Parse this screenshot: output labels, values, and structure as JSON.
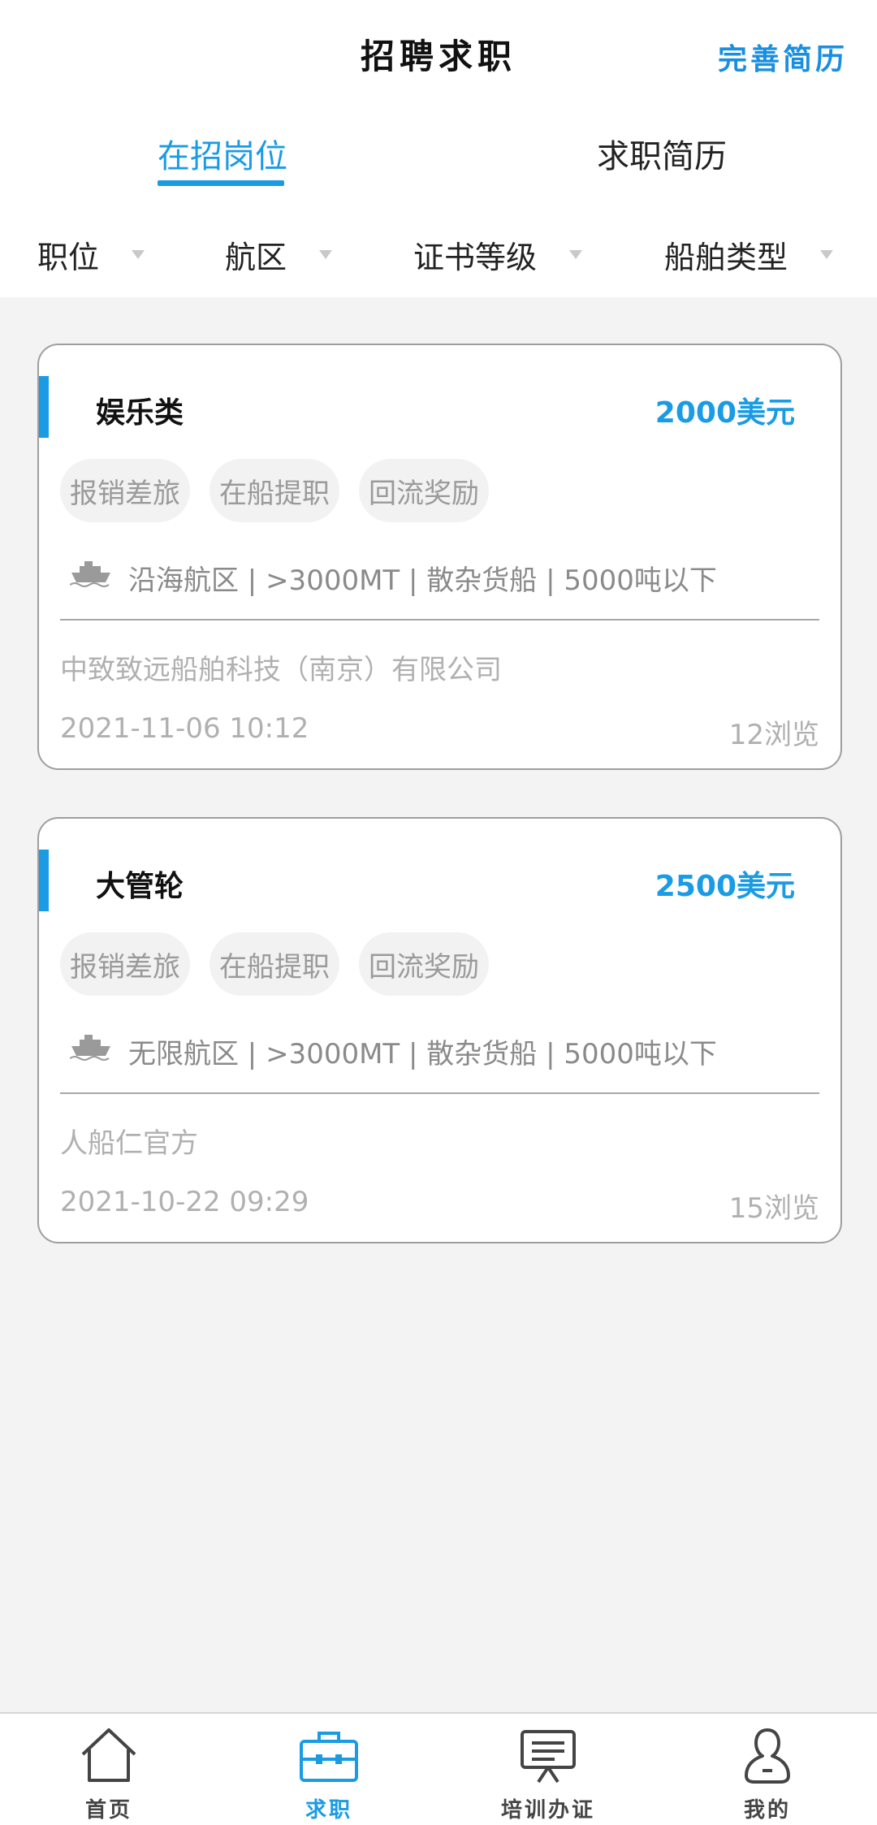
{
  "header": {
    "title": "招聘求职",
    "action_label": "完善简历"
  },
  "tabs": [
    {
      "label": "在招岗位",
      "active": true
    },
    {
      "label": "求职简历",
      "active": false
    }
  ],
  "filters": [
    {
      "label": "职位"
    },
    {
      "label": "航区"
    },
    {
      "label": "证书等级"
    },
    {
      "label": "船舶类型"
    }
  ],
  "jobs": [
    {
      "title": "娱乐类",
      "salary": "2000美元",
      "tags": [
        "报销差旅",
        "在船提职",
        "回流奖励"
      ],
      "route": "沿海航区 | >3000MT | 散杂货船 | 5000吨以下",
      "company": "中致致远船舶科技（南京）有限公司",
      "date": "2021-11-06 10:12",
      "views": "12浏览"
    },
    {
      "title": "大管轮",
      "salary": "2500美元",
      "tags": [
        "报销差旅",
        "在船提职",
        "回流奖励"
      ],
      "route": "无限航区 | >3000MT | 散杂货船 | 5000吨以下",
      "company": "人船仁官方",
      "date": "2021-10-22 09:29",
      "views": "15浏览"
    }
  ],
  "nav": [
    {
      "label": "首页",
      "icon": "home-icon",
      "active": false
    },
    {
      "label": "求职",
      "icon": "briefcase-icon",
      "active": true
    },
    {
      "label": "培训办证",
      "icon": "training-board-icon",
      "active": false
    },
    {
      "label": "我的",
      "icon": "user-icon",
      "active": false
    }
  ],
  "colors": {
    "accent": "#1a9be4",
    "background": "#f3f3f3"
  }
}
